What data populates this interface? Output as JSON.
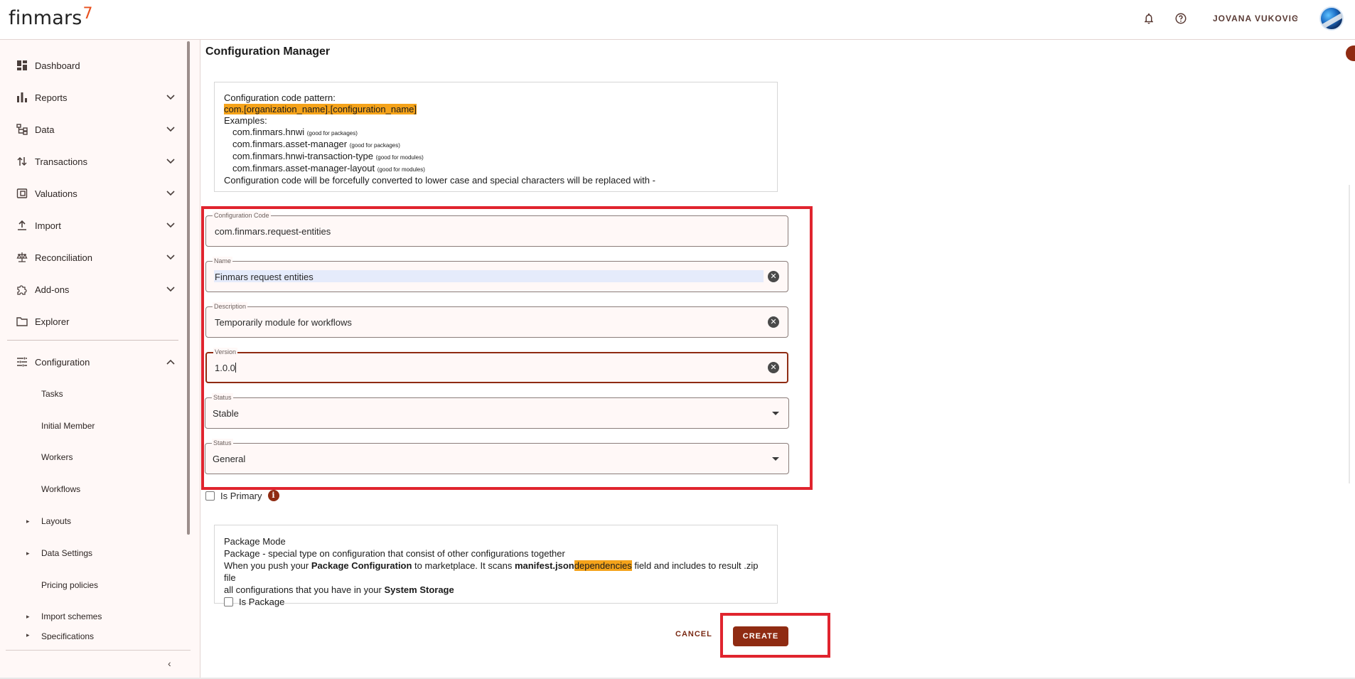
{
  "header": {
    "logo_text": "finmars",
    "logo_mark": "7",
    "bell_icon": "bell-icon",
    "help_icon": "help-icon",
    "user_name": "JOVANA VUKOVIC",
    "user_chevron": "⌄"
  },
  "sidebar": {
    "items": [
      {
        "label": "Dashboard",
        "icon": "dashboard-icon",
        "chevron": ""
      },
      {
        "label": "Reports",
        "icon": "bar-chart-icon",
        "chevron": "⌄"
      },
      {
        "label": "Data",
        "icon": "data-tree-icon",
        "chevron": "⌄"
      },
      {
        "label": "Transactions",
        "icon": "transactions-icon",
        "chevron": "⌄"
      },
      {
        "label": "Valuations",
        "icon": "valuations-icon",
        "chevron": "⌄"
      },
      {
        "label": "Import",
        "icon": "upload-icon",
        "chevron": "⌄"
      },
      {
        "label": "Reconciliation",
        "icon": "scale-icon",
        "chevron": "⌄"
      },
      {
        "label": "Add-ons",
        "icon": "puzzle-icon",
        "chevron": "⌄"
      },
      {
        "label": "Explorer",
        "icon": "folder-icon",
        "chevron": ""
      },
      {
        "label": "Configuration",
        "icon": "tune-icon",
        "chevron": "⌃"
      }
    ],
    "sub_items": [
      {
        "label": "Tasks",
        "arrow": ""
      },
      {
        "label": "Initial Member",
        "arrow": ""
      },
      {
        "label": "Workers",
        "arrow": ""
      },
      {
        "label": "Workflows",
        "arrow": ""
      },
      {
        "label": "Layouts",
        "arrow": "▸"
      },
      {
        "label": "Data Settings",
        "arrow": "▸"
      },
      {
        "label": "Pricing policies",
        "arrow": ""
      },
      {
        "label": "Import schemes",
        "arrow": "▸"
      },
      {
        "label": "Specifications",
        "arrow": "▸"
      }
    ],
    "collapse_label": "‹"
  },
  "main": {
    "title": "Configuration Manager",
    "info": {
      "pattern_label": "Configuration code pattern:",
      "pattern": "com.[organization_name].[configuration_name]",
      "examples_label": "Examples:",
      "examples": [
        {
          "code": "com.finmars.hnwi",
          "note": "(good for packages)"
        },
        {
          "code": "com.finmars.asset-manager",
          "note": "(good for packages)"
        },
        {
          "code": "com.finmars.hnwi-transaction-type",
          "note": "(good for modules)"
        },
        {
          "code": "com.finmars.asset-manager-layout",
          "note": "(good for modules)"
        }
      ],
      "footer": "Configuration code will be forcefully converted to lower case and special characters will be replaced with -"
    },
    "fields": {
      "code": {
        "label": "Configuration Code",
        "value": "com.finmars.request-entities"
      },
      "name": {
        "label": "Name",
        "value": "Finmars request entities"
      },
      "description": {
        "label": "Description",
        "value": "Temporarily module for workflows"
      },
      "version": {
        "label": "Version",
        "value": "1.0.0"
      },
      "status": {
        "label": "Status",
        "value": "Stable"
      },
      "type": {
        "label": "Status",
        "value": "General"
      }
    },
    "clear_glyph": "✕",
    "is_primary_label": "Is Primary",
    "info_glyph": "i",
    "package": {
      "title": "Package Mode",
      "line1": "Package - special type on configuration that consist of other configurations together",
      "line2_a": "When you push your ",
      "line2_b": "Package Configuration",
      "line2_c": " to marketplace. It scans ",
      "line2_d": "manifest.json",
      "line2_e": "dependencies",
      "line2_f": " field and includes to result .zip file",
      "line3_a": "all configurations that you have in your ",
      "line3_b": "System Storage",
      "is_package_label": "Is Package"
    },
    "cancel_label": "CANCEL",
    "create_label": "CREATE"
  },
  "colors": {
    "accent": "#8f2b12",
    "highlight": "#f5a31a",
    "annotation_red": "#e0242e"
  }
}
